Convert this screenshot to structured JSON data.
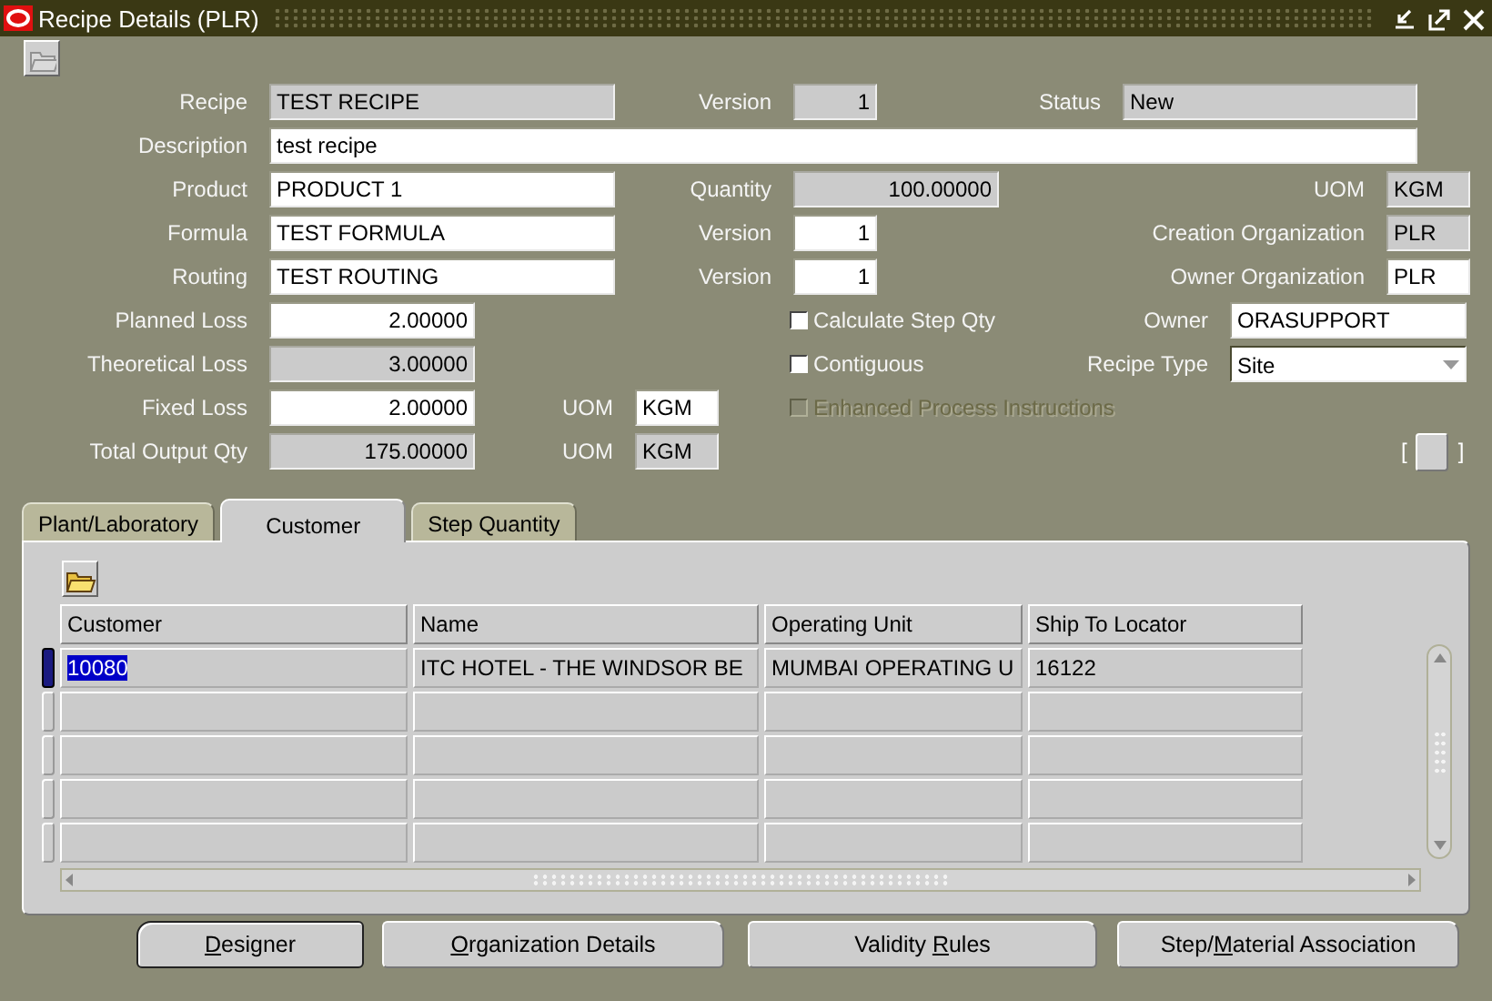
{
  "window": {
    "title": "Recipe Details (PLR)"
  },
  "form_rows": [
    [
      {
        "kind": "text",
        "label": "Recipe",
        "value": "TEST RECIPE",
        "readonly": true
      },
      {
        "kind": "number",
        "label": "Version",
        "value": "1",
        "readonly": true
      },
      {
        "kind": "text",
        "label": "Status",
        "value": "New",
        "readonly": true
      }
    ],
    [
      {
        "kind": "text",
        "label": "Description",
        "value": "test recipe",
        "readonly": false
      }
    ],
    [
      {
        "kind": "text",
        "label": "Product",
        "value": "PRODUCT 1",
        "readonly": false
      },
      {
        "kind": "number",
        "label": "Quantity",
        "value": "100.00000",
        "readonly": true
      },
      {
        "kind": "text",
        "label": "UOM",
        "value": "KGM",
        "readonly": true
      }
    ],
    [
      {
        "kind": "text",
        "label": "Formula",
        "value": "TEST FORMULA",
        "readonly": false
      },
      {
        "kind": "number",
        "label": "Version",
        "value": "1",
        "readonly": false
      },
      {
        "kind": "text",
        "label": "Creation Organization",
        "value": "PLR",
        "readonly": true
      }
    ],
    [
      {
        "kind": "text",
        "label": "Routing",
        "value": "TEST ROUTING",
        "readonly": false
      },
      {
        "kind": "number",
        "label": "Version",
        "value": "1",
        "readonly": false
      },
      {
        "kind": "text",
        "label": "Owner Organization",
        "value": "PLR",
        "readonly": false
      }
    ],
    [
      {
        "kind": "number",
        "label": "Planned Loss",
        "value": "2.00000",
        "readonly": false
      },
      {
        "kind": "checkbox",
        "label": "Calculate Step Qty",
        "checked": false,
        "disabled": false
      },
      {
        "kind": "text",
        "label": "Owner",
        "value": "ORASUPPORT",
        "readonly": false
      }
    ],
    [
      {
        "kind": "number",
        "label": "Theoretical Loss",
        "value": "3.00000",
        "readonly": true
      },
      {
        "kind": "checkbox",
        "label": "Contiguous",
        "checked": false,
        "disabled": false
      },
      {
        "kind": "dropdown",
        "label": "Recipe Type",
        "value": "Site",
        "readonly": false
      }
    ],
    [
      {
        "kind": "number",
        "label": "Fixed Loss",
        "value": "2.00000",
        "readonly": false
      },
      {
        "kind": "text",
        "label": "UOM",
        "value": "KGM",
        "readonly": false
      },
      {
        "kind": "checkbox",
        "label": "Enhanced Process Instructions",
        "checked": false,
        "disabled": true
      }
    ],
    [
      {
        "kind": "number",
        "label": "Total Output Qty",
        "value": "175.00000",
        "readonly": true
      },
      {
        "kind": "text",
        "label": "UOM",
        "value": "KGM",
        "readonly": true
      },
      {
        "kind": "flexfield",
        "open": "[",
        "close": "]"
      }
    ]
  ],
  "tabs": [
    {
      "label": "Plant/Laboratory",
      "selected": false
    },
    {
      "label": "Customer",
      "selected": true
    },
    {
      "label": "Step Quantity",
      "selected": false
    }
  ],
  "table": {
    "columns": [
      "Customer",
      "Name",
      "Operating Unit",
      "Ship To Locator"
    ],
    "rows": [
      {
        "current": true,
        "cells": [
          "10080",
          "ITC HOTEL - THE WINDSOR BE",
          "MUMBAI OPERATING U",
          "16122"
        ]
      }
    ]
  },
  "buttons": [
    {
      "key": "D",
      "post": "esigner",
      "default": true
    },
    {
      "key": "O",
      "post": "rganization Details",
      "default": false
    },
    {
      "pre": "Validity ",
      "key": "R",
      "post": "ules",
      "default": false
    },
    {
      "pre": "Step/",
      "key": "M",
      "post": "aterial Association",
      "default": false
    }
  ]
}
